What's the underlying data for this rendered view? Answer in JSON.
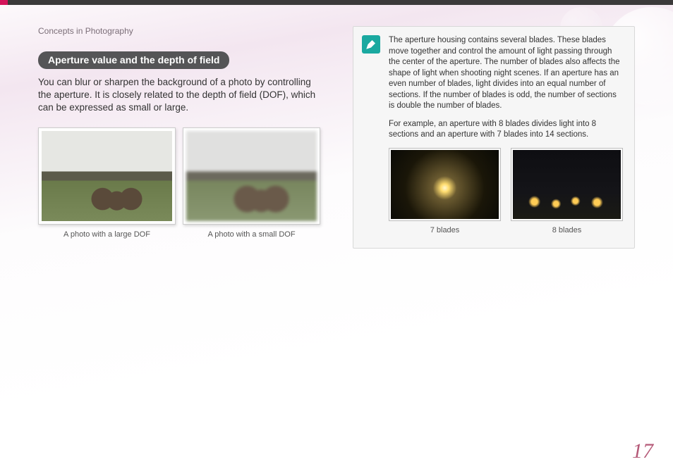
{
  "chapter": "Concepts in Photography",
  "section_title": "Aperture value and the depth of field",
  "body_text": "You can blur or sharpen the background of a photo by controlling the aperture. It is closely related to the depth of field (DOF), which can be expressed as small or large.",
  "dof_examples": [
    {
      "caption": "A photo with a large DOF"
    },
    {
      "caption": "A photo with a small DOF"
    }
  ],
  "infobox": {
    "icon_name": "pen-note-icon",
    "paragraphs": [
      "The aperture housing contains several blades. These blades move together and control the amount of light passing through the center of the aperture. The number of blades also affects the shape of light when shooting night scenes. If an aperture has an even number of blades, light divides into an equal number of sections. If the number of blades is odd, the number of sections is double the number of blades.",
      "For example, an aperture with 8 blades divides light into 8 sections and an aperture with 7 blades into 14 sections."
    ],
    "blade_examples": [
      {
        "caption": "7 blades"
      },
      {
        "caption": "8 blades"
      }
    ]
  },
  "page_number": "17"
}
